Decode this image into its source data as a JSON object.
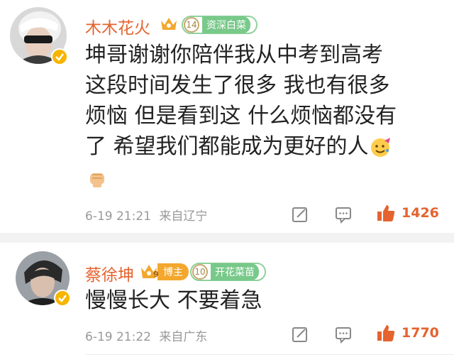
{
  "comments": [
    {
      "username": "木木花火",
      "fan_level": "14",
      "fan_title": "资深白菜",
      "text_lines": [
        "坤哥谢谢你陪伴我从中考到高考",
        "这段时间发生了很多 我也有很多",
        "烦恼 但是看到这 什么烦恼都没有",
        "了 希望我们都能成为更好的人"
      ],
      "time": "6-19 21:21",
      "location": "来自辽宁",
      "likes": "1426",
      "emojis": [
        "party-face-emoji",
        "fist-emoji"
      ]
    },
    {
      "username": "蔡徐坤",
      "badge_num": "9",
      "badge_label": "博主",
      "fan_level": "10",
      "fan_title": "开花菜苗",
      "text_lines": [
        "慢慢长大 不要着急"
      ],
      "time": "6-19 21:22",
      "location": "来自广东",
      "likes": "1770"
    }
  ],
  "icons": {
    "repost": "repost-icon",
    "comment": "comment-icon",
    "like": "thumbs-up-icon",
    "verified": "verified-badge-icon",
    "crown": "crown-icon"
  },
  "colors": {
    "username": "#e5632f",
    "likes": "#e5632f",
    "meta": "#999999",
    "fan_badge": "#78c98a",
    "blogger_badge": "#f3a72c"
  }
}
